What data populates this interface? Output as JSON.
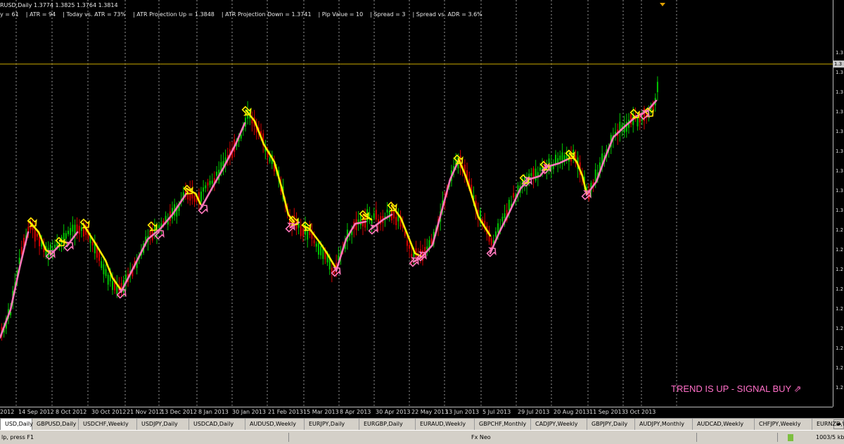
{
  "chart": {
    "header_ohlc": "RUSD,Daily  1.3774 1.3825 1.3764 1.3814",
    "info_items": [
      "y = 61",
      "ATR = 94",
      "Today vs. ATR = 73%",
      "ATR Projection Up = 1.3848",
      "ATR Projection Down = 1.3741",
      "Pip Value = 10",
      "Spread = 3",
      "Spread vs. ADR = 3.6%"
    ],
    "price_labels": [
      "1.3",
      "1.3",
      "1.3",
      "1.3",
      "1.3",
      "1.3",
      "1.3",
      "1.3",
      "1.3",
      "1.2",
      "1.2",
      "1.2",
      "1.2",
      "1.2",
      "1.2",
      "1.2",
      "1.2",
      "1.2"
    ],
    "current_price_label": "1.3",
    "signal_text": "TREND IS UP - SIGNAL BUY ⇗",
    "colors": {
      "background": "#000000",
      "bull_candle": "#00c800",
      "bear_candle": "#d40000",
      "trend_up": "#ff77bb",
      "trend_down": "#ffee00",
      "price_line": "#ccaa00",
      "grid": "#c8c8c8"
    }
  },
  "date_axis": {
    "labels": [
      "2012",
      "14 Sep 2012",
      "8 Oct 2012",
      "30 Oct 2012",
      "21 Nov 2012",
      "13 Dec 2012",
      "8 Jan 2013",
      "30 Jan 2013",
      "21 Feb 2013",
      "15 Mar 2013",
      "8 Apr 2013",
      "30 Apr 2013",
      "22 May 2013",
      "13 Jun 2013",
      "5 Jul 2013",
      "29 Jul 2013",
      "20 Aug 2013",
      "11 Sep 2013",
      "3 Oct 2013"
    ]
  },
  "tabs": [
    {
      "label": "USD,Daily",
      "active": true
    },
    {
      "label": "GBPUSD,Daily",
      "active": false
    },
    {
      "label": "USDCHF,Weekly",
      "active": false
    },
    {
      "label": "USDJPY,Daily",
      "active": false
    },
    {
      "label": "USDCAD,Daily",
      "active": false
    },
    {
      "label": "AUDUSD,Weekly",
      "active": false
    },
    {
      "label": "EURJPY,Daily",
      "active": false
    },
    {
      "label": "EURGBP,Daily",
      "active": false
    },
    {
      "label": "EURAUD,Weekly",
      "active": false
    },
    {
      "label": "GBPCHF,Monthly",
      "active": false
    },
    {
      "label": "CADJPY,Weekly",
      "active": false
    },
    {
      "label": "GBPJPY,Daily",
      "active": false
    },
    {
      "label": "AUDJPY,Monthly",
      "active": false
    },
    {
      "label": "AUDCAD,Weekly",
      "active": false
    },
    {
      "label": "CHFJPY,Weekly",
      "active": false
    },
    {
      "label": "EURNZD,Weekly",
      "active": false
    }
  ],
  "status_bar": {
    "help_text": "lp, press F1",
    "profile": "Fx Neo",
    "traffic": "1003/5 kb"
  }
}
